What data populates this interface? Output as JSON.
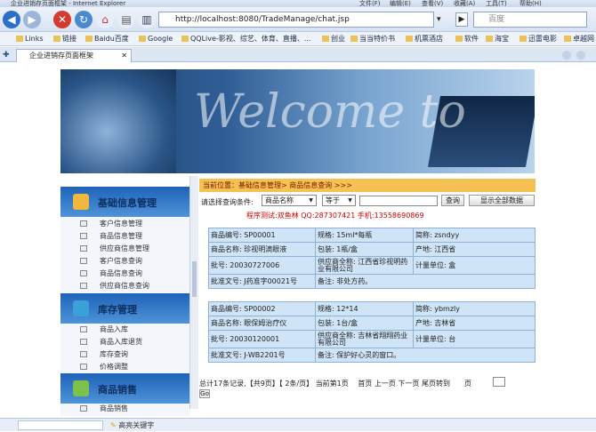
{
  "window": {
    "title": "企业进销存页面框架 - Internet Explorer",
    "menu": [
      "文件(F)",
      "编辑(E)",
      "查看(V)",
      "收藏(A)",
      "工具(T)",
      "帮助(H)"
    ]
  },
  "toolbar": {
    "url": "http://localhost:8080/TradeManage/chat.jsp",
    "search_placeholder": "百度"
  },
  "favorites": [
    "Links",
    "链接",
    "Baidu百度",
    "Google",
    "QQLive-影视、综艺、体育、直播、...",
    "创业",
    "当当特价书",
    "机票酒店",
    "软件",
    "海宝",
    "迅雷电影",
    "卓越网"
  ],
  "tab": {
    "label": "企业进销存页面框架"
  },
  "banner": {
    "text": "Welcome to"
  },
  "sidebar": {
    "sections": [
      {
        "label": "基础信息管理",
        "items": [
          "客户信息管理",
          "商品信息管理",
          "供应商信息管理",
          "客户信息查询",
          "商品信息查询",
          "供应商信息查询"
        ]
      },
      {
        "label": "库存管理",
        "items": [
          "商品入库",
          "商品入库退货",
          "库存查询",
          "价格调整"
        ]
      },
      {
        "label": "商品销售",
        "items": [
          "商品销售"
        ]
      }
    ]
  },
  "main": {
    "breadcrumb": "当前位置：基础信息管理> 商品信息查询 >>>",
    "query_label": "请选择查询条件:",
    "field_select": "商品名称",
    "op_select": "等于",
    "query_button": "查询",
    "show_all_button": "显示全部数据",
    "tip": "程序测试:双鱼林 QQ:287307421 手机:13558690869",
    "records": [
      {
        "code": "商品编号: SP00001",
        "spec": "规格: 15ml*每瓶",
        "abbr": "简称: zsndyy",
        "name": "商品名称: 珍视明滴眼液",
        "pack": "包装: 1瓶/盒",
        "origin": "产地: 江西省",
        "batch": "批号: 20030727006",
        "supplier": "供应商全称: 江西省珍视明药业有限公司",
        "unit": "计量单位: 盒",
        "approval": "批准文号: J药准字00021号",
        "note": "备注: 非处方药。"
      },
      {
        "code": "商品编号: SP00002",
        "spec": "规格: 12*14",
        "abbr": "简称: ybmzly",
        "name": "商品名称: 眼保姆治疗仪",
        "pack": "包装: 1台/盒",
        "origin": "产地: 吉林省",
        "batch": "批号: 20030120001",
        "supplier": "供应商全称: 吉林省翔翔药业有限公司",
        "unit": "计量单位: 台",
        "approval": "批准文号: J-WB2201号",
        "note": "备注: 保护好心灵的窗口。"
      }
    ],
    "pager": "总计17条记录,【共9页】【 2条/页】 当前第1页 　首页 上一页 下一页 尾页转到　　页",
    "goto": "Go"
  },
  "status": {
    "text": "高亮关键字"
  }
}
